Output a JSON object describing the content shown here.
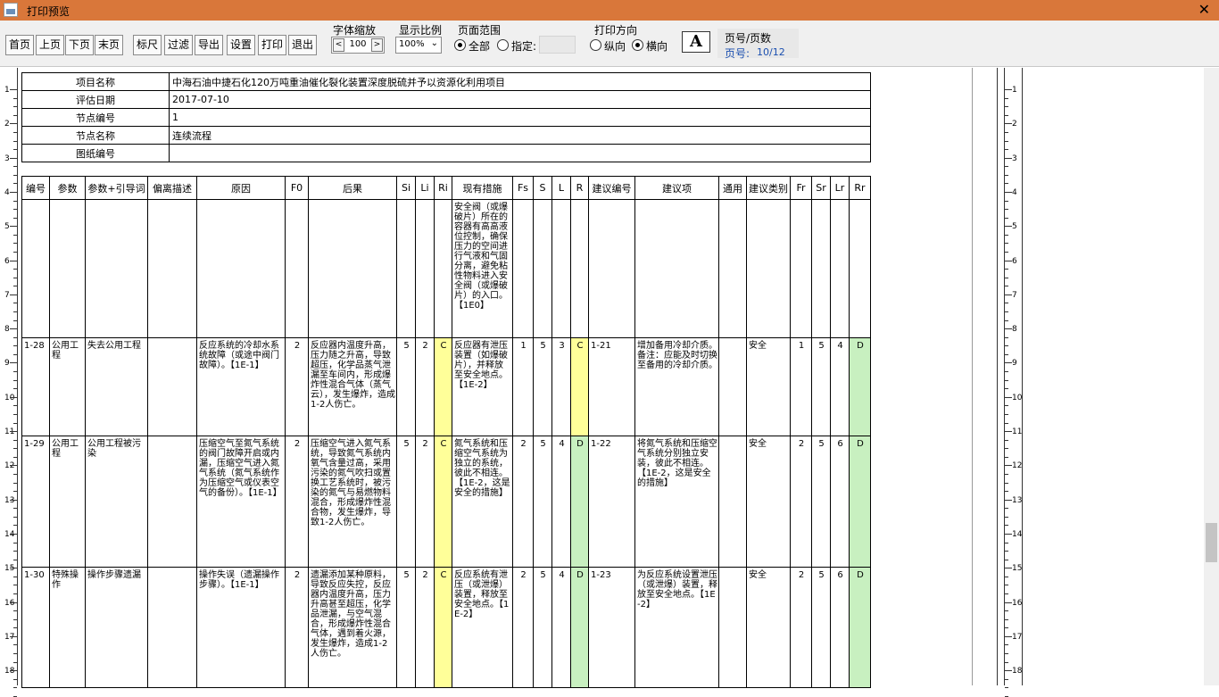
{
  "window": {
    "title": "打印预览"
  },
  "toolbar": {
    "buttons": [
      "首页",
      "上页",
      "下页",
      "末页",
      "标尺",
      "过滤",
      "导出",
      "设置",
      "打印",
      "退出"
    ],
    "font_zoom_label": "字体缩放",
    "font_zoom_value": "100",
    "scale_label": "显示比例",
    "scale_value": "100%",
    "range_label": "页面范围",
    "range_all": "全部",
    "range_custom": "指定:",
    "orientation_label": "打印方向",
    "portrait": "纵向",
    "landscape": "横向",
    "font_button": "A",
    "page_label": "页号/页数",
    "page_prefix": "页号:",
    "page_value": "10/12"
  },
  "header": {
    "rows": [
      {
        "k": "项目名称",
        "v": "中海石油中捷石化120万吨重油催化裂化装置深度脱硫并予以资源化利用项目"
      },
      {
        "k": "评估日期",
        "v": "2017-07-10"
      },
      {
        "k": "节点编号",
        "v": "1"
      },
      {
        "k": "节点名称",
        "v": "连续流程"
      },
      {
        "k": "图纸编号",
        "v": ""
      }
    ]
  },
  "table": {
    "columns": [
      "编号",
      "参数",
      "参数+引导词",
      "偏离描述",
      "原因",
      "F0",
      "后果",
      "Si",
      "Li",
      "Ri",
      "现有措施",
      "Fs",
      "S",
      "L",
      "R",
      "建议编号",
      "建议项",
      "通用",
      "建议类别",
      "Fr",
      "Sr",
      "Lr",
      "Rr"
    ],
    "rows": [
      {
        "cells": [
          "",
          "",
          "",
          "",
          "",
          "",
          "",
          "",
          "",
          "",
          "安全阀（或爆破片）所在的容器有高高液位控制，确保压力的空间进行气液和气固分离，避免粘性物料进入安全阀（或爆破片）的入口。【1E0】",
          "",
          "",
          "",
          "",
          "",
          "",
          "",
          "",
          "",
          "",
          "",
          ""
        ]
      },
      {
        "cells": [
          "1-28",
          "公用工程",
          "失去公用工程",
          "",
          "反应系统的冷却水系统故障（或途中阀门故障）。【1E-1】",
          "2",
          "反应器内温度升高，压力随之升高，导致超压，化学品蒸气泄漏至车间内，形成爆炸性混合气体（蒸气云），发生爆炸，造成1-2人伤亡。",
          "5",
          "2",
          "C",
          "反应器有泄压装置（如爆破片），并释放至安全地点。【1E-2】",
          "1",
          "5",
          "3",
          "C",
          "1-21",
          "增加备用冷却介质。备注：应能及时切换至备用的冷却介质。",
          "",
          "安全",
          "1",
          "5",
          "4",
          "D"
        ]
      },
      {
        "cells": [
          "1-29",
          "公用工程",
          "公用工程被污染",
          "",
          "压缩空气至氮气系统的阀门故障开启或内漏，压缩空气进入氮气系统（氮气系统作为压缩空气或仪表空气的备份）。【1E-1】",
          "2",
          "压缩空气进入氮气系统，导致氮气系统内氧气含量过高，采用污染的氮气吹扫或置换工艺系统时，被污染的氮气与易燃物料混合，形成爆炸性混合物，发生爆炸，导致1-2人伤亡。",
          "5",
          "2",
          "C",
          "氮气系统和压缩空气系统为独立的系统，彼此不相连。【1E-2，这是安全的措施】",
          "2",
          "5",
          "4",
          "D",
          "1-22",
          "将氮气系统和压缩空气系统分别独立安装，彼此不相连。【1E-2，这是安全的措施】",
          "",
          "安全",
          "2",
          "5",
          "6",
          "D"
        ]
      },
      {
        "cells": [
          "1-30",
          "特殊操作",
          "操作步骤遗漏",
          "",
          "操作失误（遗漏操作步骤）。【1E-1】",
          "2",
          "遗漏添加某种原料，导致反应失控，反应器内温度升高，压力升高甚至超压，化学品泄漏，与空气混合，形成爆炸性混合气体，遇到着火源，发生爆炸，造成1-2人伤亡。",
          "5",
          "2",
          "C",
          "反应系统有泄压（或泄爆）装置，释放至安全地点。【1E-2】",
          "2",
          "5",
          "4",
          "D",
          "1-23",
          "为反应系统设置泄压（或泄爆）装置，释放至安全地点。【1E-2】",
          "",
          "安全",
          "2",
          "5",
          "6",
          "D"
        ]
      }
    ]
  },
  "ruler": {
    "labels": [
      "1",
      "2",
      "3",
      "4",
      "5",
      "6",
      "7",
      "8",
      "9",
      "10",
      "11",
      "12",
      "13",
      "14",
      "15",
      "16",
      "17",
      "18"
    ]
  },
  "colors": {
    "titlebar": "#d9773a",
    "ri_highlight": "#ffff99",
    "rr_highlight": "#c8f0c0"
  }
}
